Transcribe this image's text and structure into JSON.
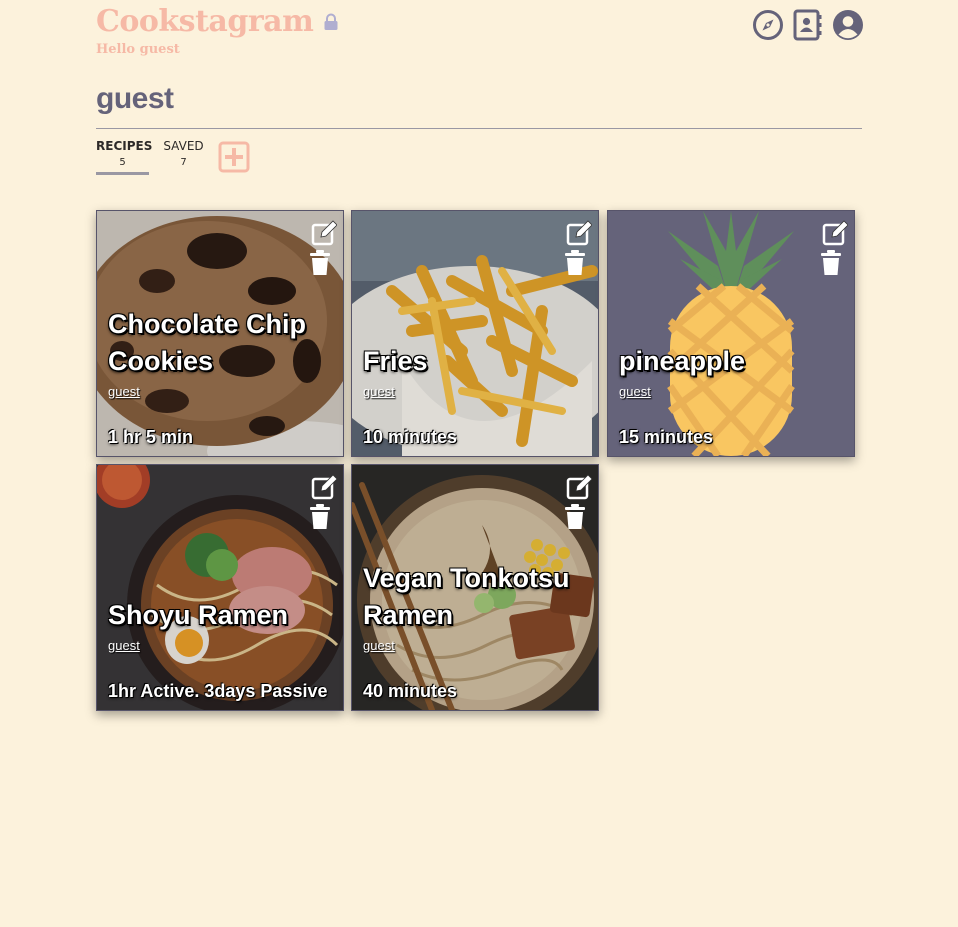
{
  "header": {
    "app_name": "Cookstagram",
    "greeting": "Hello guest",
    "nav_icons": [
      "compass-icon",
      "address-book-icon",
      "user-circle-icon"
    ]
  },
  "profile": {
    "username": "guest"
  },
  "tabs": [
    {
      "label": "RECIPES",
      "count": "5",
      "active": true
    },
    {
      "label": "SAVED",
      "count": "7",
      "active": false
    }
  ],
  "colors": {
    "background": "#fcf2dc",
    "brand": "#f6b9a6",
    "text": "#65637a",
    "card_placeholder": "#65637a"
  },
  "recipes": [
    {
      "title": "Chocolate Chip Cookies",
      "author": "guest",
      "time": "1 hr 5 min"
    },
    {
      "title": "Fries",
      "author": "guest",
      "time": "10 minutes"
    },
    {
      "title": "pineapple",
      "author": "guest",
      "time": "15 minutes"
    },
    {
      "title": "Shoyu Ramen",
      "author": "guest",
      "time": "1hr Active. 3days Passive"
    },
    {
      "title": "Vegan Tonkotsu Ramen",
      "author": "guest",
      "time": "40 minutes"
    }
  ]
}
